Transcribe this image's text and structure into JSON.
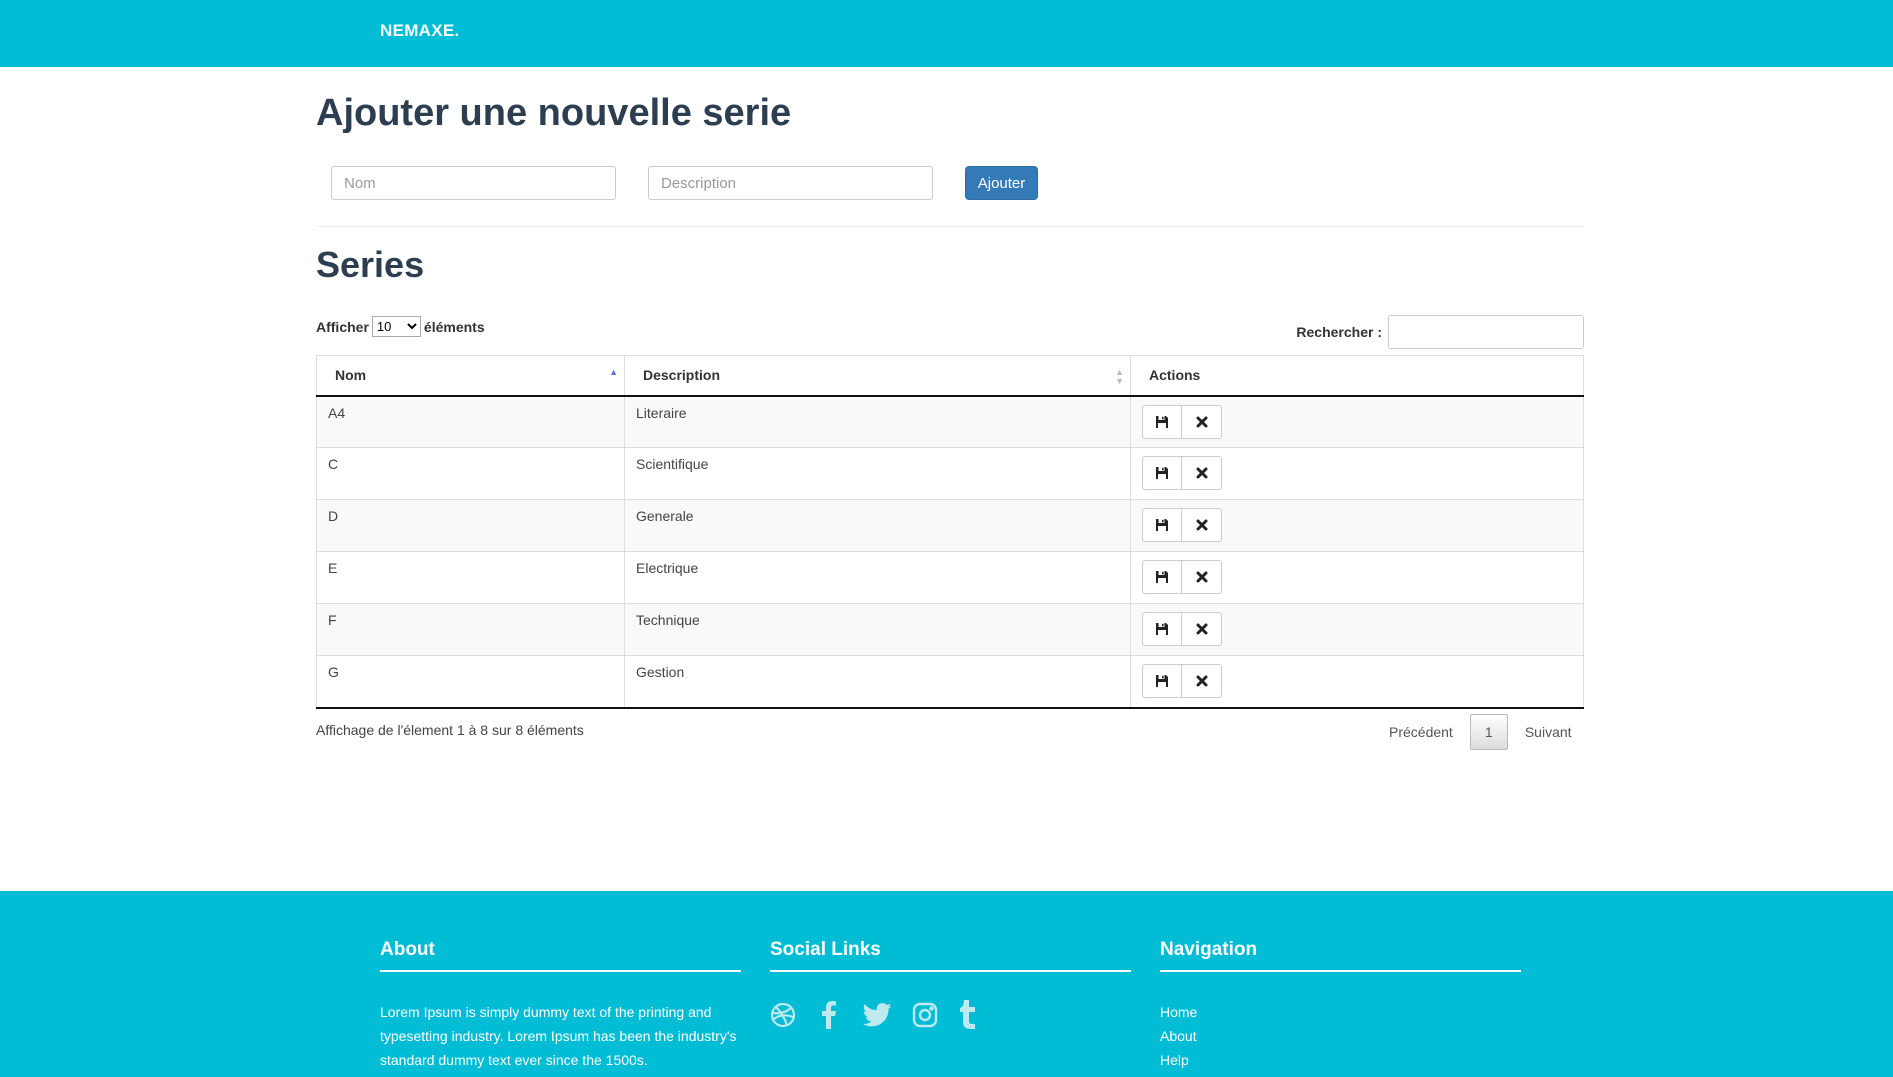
{
  "header": {
    "brand": "NEMAXE."
  },
  "form": {
    "title": "Ajouter une nouvelle serie",
    "name_placeholder": "Nom",
    "description_placeholder": "Description",
    "submit_label": "Ajouter"
  },
  "list": {
    "title": "Series",
    "length_prefix": "Afficher",
    "length_value": "10",
    "length_suffix": "éléments",
    "search_label": "Rechercher :",
    "columns": [
      "Nom",
      "Description",
      "Actions"
    ],
    "rows": [
      {
        "nom": "A4",
        "description": "Literaire"
      },
      {
        "nom": "C",
        "description": "Scientifique"
      },
      {
        "nom": "D",
        "description": "Generale"
      },
      {
        "nom": "E",
        "description": "Electrique"
      },
      {
        "nom": "F",
        "description": "Technique"
      },
      {
        "nom": "G",
        "description": "Gestion"
      }
    ],
    "info": "Affichage de l'élement 1 à 8 sur 8 éléments",
    "pagination": {
      "previous": "Précédent",
      "current_page": "1",
      "next": "Suivant"
    }
  },
  "footer": {
    "about": {
      "title": "About",
      "text": "Lorem Ipsum is simply dummy text of the printing and typesetting industry. Lorem Ipsum has been the industry's standard dummy text ever since the 1500s."
    },
    "social": {
      "title": "Social Links",
      "icons": [
        "dribbble-icon",
        "facebook-icon",
        "twitter-icon",
        "instagram-icon",
        "tumblr-icon"
      ]
    },
    "navigation": {
      "title": "Navigation",
      "links": [
        "Home",
        "About",
        "Help"
      ]
    }
  },
  "colors": {
    "primary": "#00bcd4",
    "button": "#337ab7",
    "heading": "#2c3e50"
  }
}
